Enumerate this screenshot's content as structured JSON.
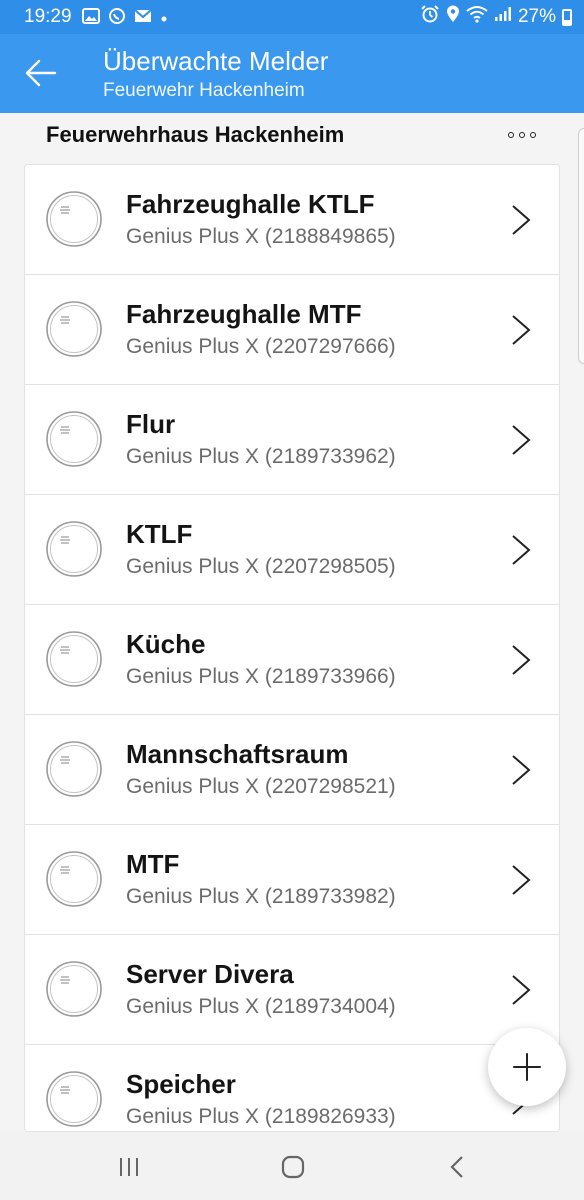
{
  "status_bar": {
    "time": "19:29",
    "left_icons": [
      "gallery-icon",
      "whatsapp-icon",
      "mail-icon",
      "dot-icon"
    ],
    "right_icons": [
      "alarm-icon",
      "location-icon",
      "wifi-icon",
      "signal-icon"
    ],
    "battery": "27%"
  },
  "app_bar": {
    "title": "Überwachte Melder",
    "subtitle": "Feuerwehr Hackenheim"
  },
  "section": {
    "title": "Feuerwehrhaus Hackenheim"
  },
  "devices": [
    {
      "name": "Fahrzeughalle KTLF",
      "model": "Genius Plus X (2188849865)"
    },
    {
      "name": "Fahrzeughalle MTF",
      "model": "Genius Plus X (2207297666)"
    },
    {
      "name": "Flur",
      "model": "Genius Plus X (2189733962)"
    },
    {
      "name": "KTLF",
      "model": "Genius Plus X (2207298505)"
    },
    {
      "name": "Küche",
      "model": "Genius Plus X (2189733966)"
    },
    {
      "name": "Mannschaftsraum",
      "model": "Genius Plus X (2207298521)"
    },
    {
      "name": "MTF",
      "model": "Genius Plus X (2189733982)"
    },
    {
      "name": "Server Divera",
      "model": "Genius Plus X (2189734004)"
    },
    {
      "name": "Speicher",
      "model": "Genius Plus X (2189826933)"
    }
  ],
  "colors": {
    "status_bar": "#2f8ee8",
    "app_bar": "#3a98ee",
    "background": "#f4f4f4"
  }
}
